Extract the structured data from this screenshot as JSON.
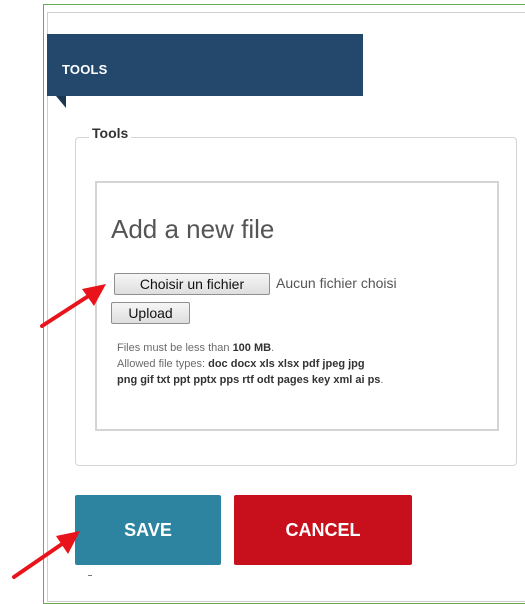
{
  "panel": {
    "title": "TOOLS"
  },
  "fieldset": {
    "legend": "Tools"
  },
  "upload": {
    "heading": "Add a new file",
    "choose_button": "Choisir un fichier",
    "no_file_text": "Aucun fichier choisi",
    "upload_button": "Upload",
    "size_prefix": "Files must be less than ",
    "size_limit": "100 MB",
    "size_suffix": ".",
    "types_prefix": "Allowed file types: ",
    "types_line1": "doc docx xls xlsx pdf jpeg jpg",
    "types_line2": "png gif txt ppt pptx pps rtf odt pages key xml ai ps",
    "types_suffix": "."
  },
  "actions": {
    "save_label": "SAVE",
    "cancel_label": "CANCEL"
  },
  "colors": {
    "header_band": "#24486b",
    "save_button": "#2d84a1",
    "cancel_button": "#c8101d",
    "annotation_arrow": "#e8131b",
    "frame_border": "#6aaa4f"
  },
  "icons": {
    "annotation_arrows": "red-arrow-icon"
  }
}
